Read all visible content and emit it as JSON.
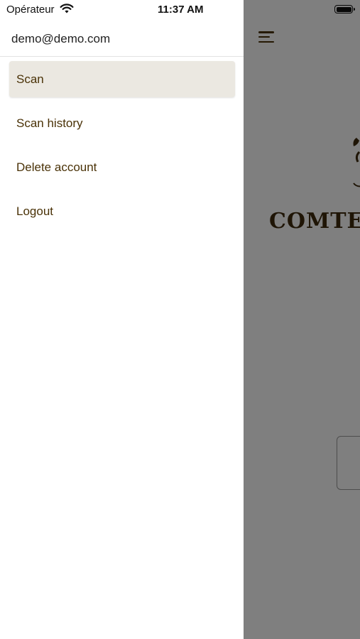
{
  "status_bar": {
    "carrier": "Opérateur",
    "time": "11:37 AM",
    "wifi_icon": "wifi-icon",
    "battery_icon": "battery-icon"
  },
  "drawer": {
    "account_email": "demo@demo.com",
    "items": [
      {
        "label": "Scan",
        "active": true
      },
      {
        "label": "Scan history",
        "active": false
      },
      {
        "label": "Delete account",
        "active": false
      },
      {
        "label": "Logout",
        "active": false
      }
    ]
  },
  "background": {
    "menu_icon": "hamburger-menu-icon",
    "brand_text": "COMTE",
    "logo_icon": "brand-logo-icon"
  },
  "colors": {
    "accent_text": "#4a3207",
    "active_item_bg": "#ebe8e1",
    "scrim": "rgba(0,0,0,0.5)"
  }
}
